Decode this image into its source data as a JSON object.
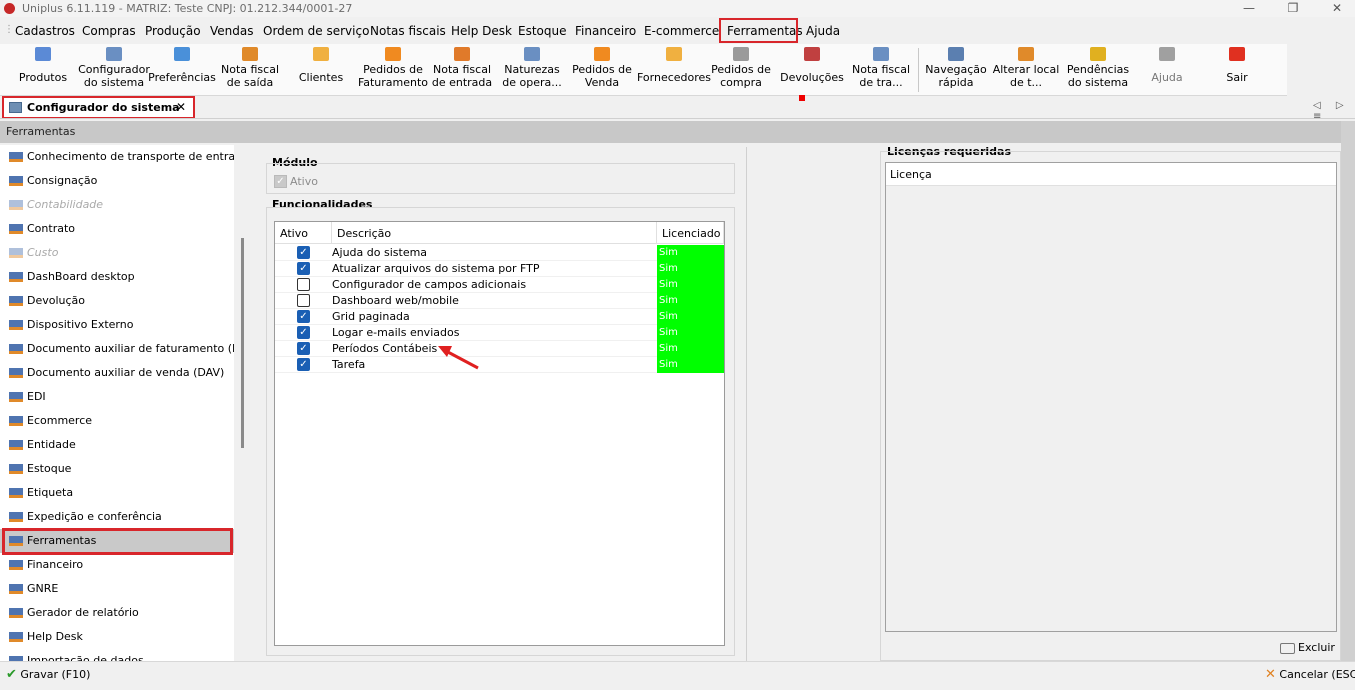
{
  "window": {
    "title": "Uniplus 6.11.119 - MATRIZ: Teste CNPJ: 01.212.344/0001-27",
    "controls": [
      "—",
      "❐",
      "✕"
    ]
  },
  "menu": [
    "Cadastros",
    "Compras",
    "Produção",
    "Vendas",
    "Ordem de serviço",
    "Notas fiscais",
    "Help Desk",
    "Estoque",
    "Financeiro",
    "E-commerce",
    "Ferramentas",
    "Ajuda"
  ],
  "toolbar": [
    {
      "label": "Produtos",
      "icon": "products-icon",
      "color": "#5b8ad6"
    },
    {
      "label": "Configurador\ndo sistema",
      "icon": "configurator-icon",
      "color": "#6a8fc2"
    },
    {
      "label": "Preferências",
      "icon": "preferences-icon",
      "color": "#4a90d9"
    },
    {
      "label": "Nota fiscal\nde saída",
      "icon": "invoice-out-icon",
      "color": "#e08a2a"
    },
    {
      "label": "Clientes",
      "icon": "clients-icon",
      "color": "#f0b040"
    },
    {
      "label": "Pedidos de\nFaturamento",
      "icon": "billing-orders-icon",
      "color": "#f08a20"
    },
    {
      "label": "Nota fiscal\nde entrada",
      "icon": "invoice-in-icon",
      "color": "#e07a2a"
    },
    {
      "label": "Naturezas\nde opera...",
      "icon": "operations-icon",
      "color": "#6a8fc2"
    },
    {
      "label": "Pedidos de\nVenda",
      "icon": "sales-orders-icon",
      "color": "#f08a20"
    },
    {
      "label": "Fornecedores",
      "icon": "suppliers-icon",
      "color": "#f0b040"
    },
    {
      "label": "Pedidos de\ncompra",
      "icon": "purchase-orders-icon",
      "color": "#9a9a9a"
    },
    {
      "label": "Devoluções",
      "icon": "returns-icon",
      "color": "#c04040"
    },
    {
      "label": "Nota fiscal\nde tra...",
      "icon": "invoice-transfer-icon",
      "color": "#6a8fc2"
    },
    {
      "label": "Navegação\nrápida",
      "icon": "quick-nav-icon",
      "color": "#5b7fb0"
    },
    {
      "label": "Alterar local\nde t...",
      "icon": "change-location-icon",
      "color": "#e08a2a"
    },
    {
      "label": "Pendências\ndo sistema",
      "icon": "warning-icon",
      "color": "#e0b020"
    },
    {
      "label": "Ajuda",
      "icon": "help-icon",
      "color": "#a0a0a0"
    },
    {
      "label": "Sair",
      "icon": "exit-icon",
      "color": "#e03020"
    }
  ],
  "tab": {
    "label": "Configurador do sistema",
    "close": "✕",
    "nav": "◁ ▷ ≡"
  },
  "section_header": "Ferramentas",
  "left_list": [
    {
      "label": "Conhecimento de transporte de entrada",
      "enabled": true
    },
    {
      "label": "Consignação",
      "enabled": true
    },
    {
      "label": "Contabilidade",
      "enabled": false
    },
    {
      "label": "Contrato",
      "enabled": true
    },
    {
      "label": "Custo",
      "enabled": false
    },
    {
      "label": "DashBoard desktop",
      "enabled": true
    },
    {
      "label": "Devolução",
      "enabled": true
    },
    {
      "label": "Dispositivo Externo",
      "enabled": true
    },
    {
      "label": "Documento auxiliar de faturamento (DAF)",
      "enabled": true
    },
    {
      "label": "Documento auxiliar de venda (DAV)",
      "enabled": true
    },
    {
      "label": "EDI",
      "enabled": true
    },
    {
      "label": "Ecommerce",
      "enabled": true
    },
    {
      "label": "Entidade",
      "enabled": true
    },
    {
      "label": "Estoque",
      "enabled": true
    },
    {
      "label": "Etiqueta",
      "enabled": true
    },
    {
      "label": "Expedição e conferência",
      "enabled": true
    },
    {
      "label": "Ferramentas",
      "enabled": true,
      "selected": true
    },
    {
      "label": "Financeiro",
      "enabled": true
    },
    {
      "label": "GNRE",
      "enabled": true
    },
    {
      "label": "Gerador de relatório",
      "enabled": true
    },
    {
      "label": "Help Desk",
      "enabled": true
    },
    {
      "label": "Importação de dados",
      "enabled": true
    }
  ],
  "module": {
    "title": "Módulo",
    "active_label": "Ativo",
    "active": true
  },
  "features": {
    "title": "Funcionalidades",
    "columns": [
      "Ativo",
      "Descrição",
      "Licenciado"
    ],
    "rows": [
      {
        "active": true,
        "desc": "Ajuda do sistema",
        "licensed": "Sim"
      },
      {
        "active": true,
        "desc": "Atualizar arquivos do sistema por FTP",
        "licensed": "Sim"
      },
      {
        "active": false,
        "desc": "Configurador de campos adicionais",
        "licensed": "Sim"
      },
      {
        "active": false,
        "desc": "Dashboard web/mobile",
        "licensed": "Sim"
      },
      {
        "active": true,
        "desc": "Grid paginada",
        "licensed": "Sim"
      },
      {
        "active": true,
        "desc": "Logar e-mails enviados",
        "licensed": "Sim"
      },
      {
        "active": true,
        "desc": "Períodos Contábeis",
        "licensed": "Sim"
      },
      {
        "active": true,
        "desc": "Tarefa",
        "licensed": "Sim"
      }
    ]
  },
  "licenses": {
    "title": "Licenças requeridas",
    "column": "Licença"
  },
  "buttons": {
    "delete": "Excluir",
    "save": "Gravar (F10)",
    "cancel": "Cancelar (ESC)"
  },
  "colors": {
    "highlight": "#d8262b",
    "licensed": "#00ff00",
    "checkbox": "#1a5fb4"
  }
}
